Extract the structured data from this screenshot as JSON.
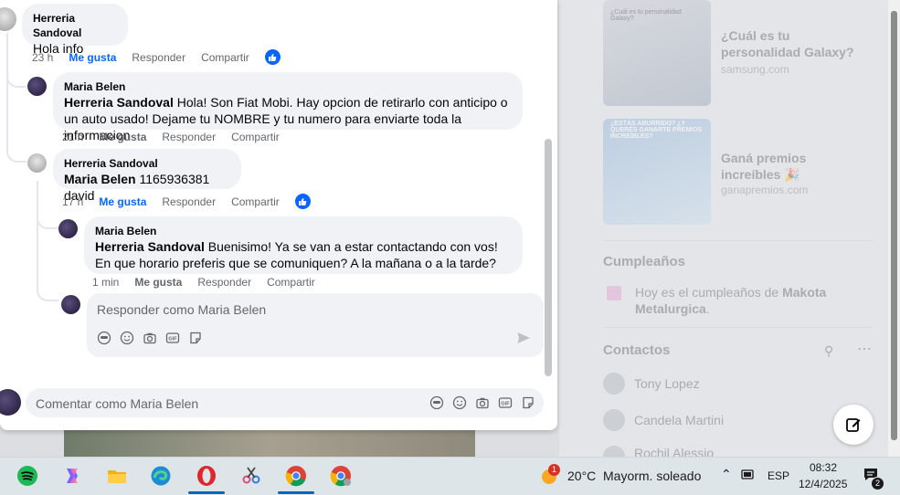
{
  "ads": [
    {
      "title": "¿Cuál es tu personalidad Galaxy?",
      "domain": "samsung.com",
      "thumb_text": "¿Cuál es tu personalidad Galaxy?"
    },
    {
      "title": "Ganá premios increíbles",
      "domain": "ganapremios.com",
      "thumb_text": "¿ESTÁS ABURRIDO? ¿Y QUERÉS GANARTE PREMIOS INCREÍBLES?"
    }
  ],
  "birthdays": {
    "title": "Cumpleaños",
    "text_prefix": "Hoy es el cumpleaños de ",
    "person": "Makota Metalurgica",
    "suffix": "."
  },
  "contacts": {
    "title": "Contactos",
    "items": [
      "Tony Lopez",
      "Candela Martini",
      "Rochil Alessio"
    ]
  },
  "comments": [
    {
      "author": "Herreria Sandoval",
      "text": "Hola info",
      "time": "23 h",
      "like": "Me gusta",
      "reply": "Responder",
      "share": "Compartir",
      "liked": true
    },
    {
      "author": "Maria Belen",
      "mention": "Herreria Sandoval",
      "text": " Hola! Son Fiat Mobi. Hay opcion de retirarlo con anticipo o un auto usado! Dejame tu NOMBRE y tu numero para enviarte toda la informacion",
      "time": "21 h",
      "like": "Me gusta",
      "reply": "Responder",
      "share": "Compartir",
      "liked": false
    },
    {
      "author": "Herreria Sandoval",
      "mention": "Maria Belen",
      "text": " 1165936381 david",
      "time": "17 h",
      "like": "Me gusta",
      "reply": "Responder",
      "share": "Compartir",
      "liked": true
    },
    {
      "author": "Maria Belen",
      "mention": "Herreria Sandoval",
      "text": " Buenisimo! Ya se van a estar contactando con vos! En que horario preferis que se comuniquen? A la mañana o a la tarde?",
      "time": "1 min",
      "like": "Me gusta",
      "reply": "Responder",
      "share": "Compartir",
      "liked": false
    }
  ],
  "reply_box": {
    "placeholder": "Responder como Maria Belen"
  },
  "comment_box": {
    "placeholder": "Comentar como Maria Belen"
  },
  "taskbar": {
    "weather_temp": "20°C",
    "weather_desc": "Mayorm. soleado",
    "weather_badge": "1",
    "lang": "ESP",
    "time": "08:32",
    "date": "12/4/2025",
    "notif_count": "2"
  },
  "colors": {
    "accent": "#0866ff",
    "bubble": "#f0f2f5"
  }
}
